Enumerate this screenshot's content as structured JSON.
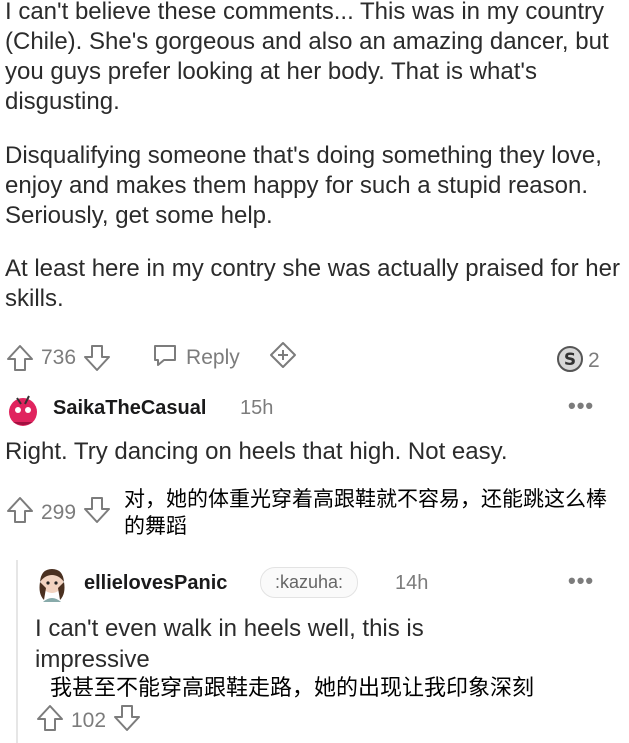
{
  "parent_comment": {
    "paragraphs": [
      "I can't believe these comments... This was in my country (Chile). She's gorgeous and also an amazing dancer, but you guys prefer looking at her body. That is what's disgusting.",
      "Disqualifying someone that's doing something they love, enjoy and makes them happy for such a stupid reason. Seriously, get some help.",
      "At least here in my contry she was actually praised for her skills."
    ],
    "upvotes": "736",
    "reply_label": "Reply",
    "award_count": "2"
  },
  "comment_2": {
    "username": "SaikaTheCasual",
    "age": "15h",
    "more": "•••",
    "text": "Right. Try dancing on heels that high. Not easy.",
    "upvotes": "299",
    "caption": "对，她的体重光穿着高跟鞋就不容易，还能跳这么棒的舞蹈"
  },
  "comment_3": {
    "username": "ellielovesPanic",
    "flair": ":kazuha:",
    "age": "14h",
    "more": "•••",
    "text": "I can't even walk in heels well, this is impressive",
    "caption": "我甚至不能穿高跟鞋走路，她的出现让我印象深刻",
    "upvotes": "102"
  },
  "colors": {
    "text": "#2b2b2b",
    "muted": "#7c7c7c",
    "avatar_pink": "#e0245e"
  },
  "icons": [
    "upvote-icon",
    "downvote-icon",
    "reply-icon",
    "add-icon",
    "award-icon",
    "more-icon"
  ]
}
